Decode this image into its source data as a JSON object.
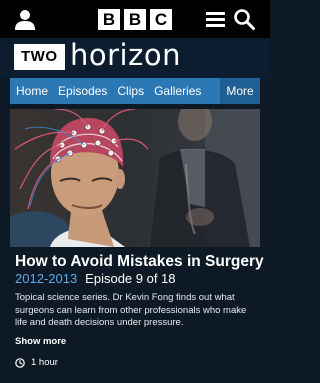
{
  "header": {
    "account_icon": "user-icon",
    "logo_letters": [
      "B",
      "B",
      "C"
    ],
    "menu_icon": "menu-icon",
    "search_icon": "search-icon"
  },
  "brand": {
    "channel": "TWO",
    "programme": "horizon"
  },
  "nav": {
    "items": [
      "Home",
      "Episodes",
      "Clips",
      "Galleries"
    ],
    "more": "More"
  },
  "episode": {
    "title": "How to Avoid Mistakes in Surgery",
    "years": "2012-2013",
    "episode_info": "Episode 9 of 18",
    "description": "Topical science series. Dr Kevin Fong finds out what surgeons can learn from other professionals who make life and death decisions under pressure.",
    "show_more": "Show more",
    "duration": "1 hour"
  },
  "colors": {
    "background": "#0d1a26",
    "nav": "#2b78b5",
    "accent": "#5ea9e6"
  }
}
